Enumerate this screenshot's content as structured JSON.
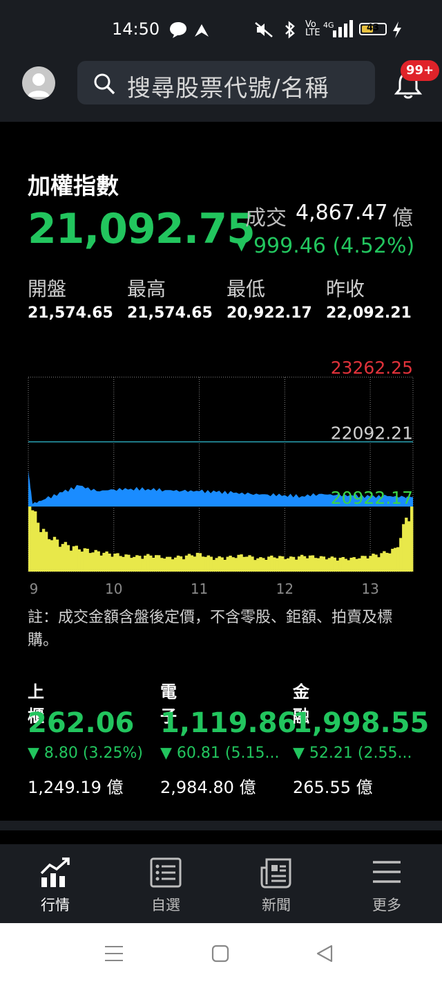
{
  "status_bar": {
    "time": "14:50",
    "battery": "43"
  },
  "header": {
    "search_placeholder": "搜尋股票代號/名稱",
    "badge": "99+"
  },
  "index": {
    "name": "加權指數",
    "value": "21,092.75",
    "volume_label": "成交",
    "volume_value": "4,867.47",
    "volume_unit": "億",
    "change": "999.46 (4.52%)",
    "change_arrow": "▼"
  },
  "ohlc": [
    {
      "label": "開盤",
      "value": "21,574.65"
    },
    {
      "label": "最高",
      "value": "21,574.65"
    },
    {
      "label": "最低",
      "value": "20,922.17"
    },
    {
      "label": "昨收",
      "value": "22,092.21"
    }
  ],
  "chart_data": {
    "type": "area",
    "price_labels": {
      "top": "23262.25",
      "ref": "22092.21",
      "bottom": "20922.17"
    },
    "x_ticks": [
      "9",
      "10",
      "11",
      "12",
      "13"
    ],
    "ylim": [
      20922.17,
      23262.25
    ],
    "reference": 22092.21,
    "x": [
      9.0,
      9.05,
      9.2,
      9.4,
      9.6,
      9.8,
      10.0,
      10.2,
      10.4,
      10.6,
      10.8,
      11.0,
      11.2,
      11.4,
      11.6,
      11.8,
      12.0,
      12.2,
      12.4,
      12.6,
      12.8,
      13.0,
      13.2,
      13.4,
      13.5
    ],
    "values": [
      21574,
      20970,
      21060,
      21180,
      21300,
      21200,
      21230,
      21245,
      21240,
      21220,
      21205,
      21200,
      21185,
      21170,
      21150,
      21140,
      21130,
      21110,
      21150,
      21130,
      21120,
      21100,
      21110,
      21095,
      21093
    ],
    "volume_series": [
      0.95,
      0.55,
      0.42,
      0.35,
      0.3,
      0.27,
      0.24,
      0.22,
      0.24,
      0.2,
      0.22,
      0.26,
      0.2,
      0.21,
      0.24,
      0.19,
      0.22,
      0.2,
      0.23,
      0.21,
      0.2,
      0.19,
      0.22,
      0.26,
      0.33,
      1.0
    ],
    "colors": {
      "area": "#1a8cff",
      "volume": "#e8e84a",
      "ref_line": "#2aa6b8",
      "top_label": "#e0323a",
      "bottom_label": "#3cd448"
    }
  },
  "note": "註：成交金額含盤後定價，不含零股、鉅額、拍賣及標購。",
  "sub_indices": [
    {
      "name": "上櫃",
      "value": "262.06",
      "change": "▼ 8.80 (3.25%)",
      "amount": "1,249.19 億"
    },
    {
      "name": "電子",
      "value": "1,119.86",
      "change": "▼ 60.81 (5.15...",
      "amount": "2,984.80 億"
    },
    {
      "name": "金融",
      "value": "1,998.55",
      "change": "▼ 52.21 (2.55...",
      "amount": "265.55 億"
    }
  ],
  "bottom_nav": [
    {
      "label": "行情",
      "icon": "chart-icon",
      "active": true
    },
    {
      "label": "自選",
      "icon": "list-icon",
      "active": false
    },
    {
      "label": "新聞",
      "icon": "news-icon",
      "active": false
    },
    {
      "label": "更多",
      "icon": "menu-icon",
      "active": false
    }
  ]
}
